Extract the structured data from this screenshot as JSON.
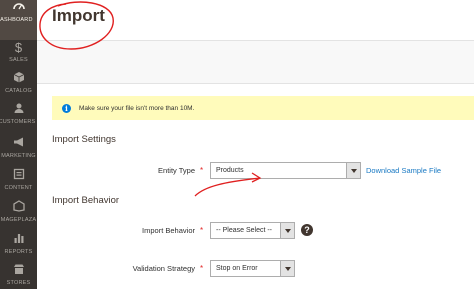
{
  "sidebar": {
    "items": [
      {
        "label": "DASHBOARD",
        "icon": "dashboard-icon",
        "active": true
      },
      {
        "label": "SALES",
        "icon": "dollar-icon"
      },
      {
        "label": "CATALOG",
        "icon": "cube-icon"
      },
      {
        "label": "CUSTOMERS",
        "icon": "customers-icon"
      },
      {
        "label": "MARKETING",
        "icon": "megaphone-icon"
      },
      {
        "label": "CONTENT",
        "icon": "content-icon"
      },
      {
        "label": "MAGEPLAZA",
        "icon": "mageplaza-icon"
      },
      {
        "label": "REPORTS",
        "icon": "bar-chart-icon"
      },
      {
        "label": "STORES",
        "icon": "store-icon"
      }
    ]
  },
  "page": {
    "title": "Import"
  },
  "notice": {
    "text": "Make sure your file isn't more than 10M."
  },
  "import_settings": {
    "title": "Import Settings",
    "entity_type_label": "Entity Type",
    "entity_type_value": "Products",
    "download_link": "Download Sample File"
  },
  "import_behavior": {
    "title": "Import Behavior",
    "behavior_label": "Import Behavior",
    "behavior_value": "-- Please Select --",
    "validation_label": "Validation Strategy",
    "validation_value": "Stop on Error"
  },
  "colors": {
    "sidebar_bg": "#373330",
    "link": "#1979c3",
    "required": "#e22626",
    "annotation": "#e02020",
    "notice_bg": "#fffbbb"
  }
}
